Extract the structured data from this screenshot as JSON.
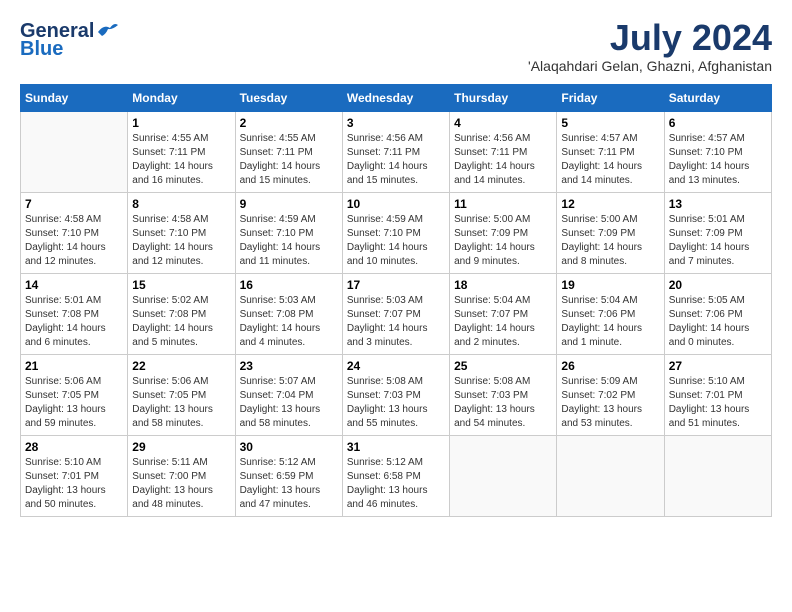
{
  "header": {
    "logo_general": "General",
    "logo_blue": "Blue",
    "title": "July 2024",
    "location": "'Alaqahdari Gelan, Ghazni, Afghanistan"
  },
  "days_of_week": [
    "Sunday",
    "Monday",
    "Tuesday",
    "Wednesday",
    "Thursday",
    "Friday",
    "Saturday"
  ],
  "weeks": [
    [
      {
        "day": "",
        "info": ""
      },
      {
        "day": "1",
        "info": "Sunrise: 4:55 AM\nSunset: 7:11 PM\nDaylight: 14 hours\nand 16 minutes."
      },
      {
        "day": "2",
        "info": "Sunrise: 4:55 AM\nSunset: 7:11 PM\nDaylight: 14 hours\nand 15 minutes."
      },
      {
        "day": "3",
        "info": "Sunrise: 4:56 AM\nSunset: 7:11 PM\nDaylight: 14 hours\nand 15 minutes."
      },
      {
        "day": "4",
        "info": "Sunrise: 4:56 AM\nSunset: 7:11 PM\nDaylight: 14 hours\nand 14 minutes."
      },
      {
        "day": "5",
        "info": "Sunrise: 4:57 AM\nSunset: 7:11 PM\nDaylight: 14 hours\nand 14 minutes."
      },
      {
        "day": "6",
        "info": "Sunrise: 4:57 AM\nSunset: 7:10 PM\nDaylight: 14 hours\nand 13 minutes."
      }
    ],
    [
      {
        "day": "7",
        "info": "Sunrise: 4:58 AM\nSunset: 7:10 PM\nDaylight: 14 hours\nand 12 minutes."
      },
      {
        "day": "8",
        "info": "Sunrise: 4:58 AM\nSunset: 7:10 PM\nDaylight: 14 hours\nand 12 minutes."
      },
      {
        "day": "9",
        "info": "Sunrise: 4:59 AM\nSunset: 7:10 PM\nDaylight: 14 hours\nand 11 minutes."
      },
      {
        "day": "10",
        "info": "Sunrise: 4:59 AM\nSunset: 7:10 PM\nDaylight: 14 hours\nand 10 minutes."
      },
      {
        "day": "11",
        "info": "Sunrise: 5:00 AM\nSunset: 7:09 PM\nDaylight: 14 hours\nand 9 minutes."
      },
      {
        "day": "12",
        "info": "Sunrise: 5:00 AM\nSunset: 7:09 PM\nDaylight: 14 hours\nand 8 minutes."
      },
      {
        "day": "13",
        "info": "Sunrise: 5:01 AM\nSunset: 7:09 PM\nDaylight: 14 hours\nand 7 minutes."
      }
    ],
    [
      {
        "day": "14",
        "info": "Sunrise: 5:01 AM\nSunset: 7:08 PM\nDaylight: 14 hours\nand 6 minutes."
      },
      {
        "day": "15",
        "info": "Sunrise: 5:02 AM\nSunset: 7:08 PM\nDaylight: 14 hours\nand 5 minutes."
      },
      {
        "day": "16",
        "info": "Sunrise: 5:03 AM\nSunset: 7:08 PM\nDaylight: 14 hours\nand 4 minutes."
      },
      {
        "day": "17",
        "info": "Sunrise: 5:03 AM\nSunset: 7:07 PM\nDaylight: 14 hours\nand 3 minutes."
      },
      {
        "day": "18",
        "info": "Sunrise: 5:04 AM\nSunset: 7:07 PM\nDaylight: 14 hours\nand 2 minutes."
      },
      {
        "day": "19",
        "info": "Sunrise: 5:04 AM\nSunset: 7:06 PM\nDaylight: 14 hours\nand 1 minute."
      },
      {
        "day": "20",
        "info": "Sunrise: 5:05 AM\nSunset: 7:06 PM\nDaylight: 14 hours\nand 0 minutes."
      }
    ],
    [
      {
        "day": "21",
        "info": "Sunrise: 5:06 AM\nSunset: 7:05 PM\nDaylight: 13 hours\nand 59 minutes."
      },
      {
        "day": "22",
        "info": "Sunrise: 5:06 AM\nSunset: 7:05 PM\nDaylight: 13 hours\nand 58 minutes."
      },
      {
        "day": "23",
        "info": "Sunrise: 5:07 AM\nSunset: 7:04 PM\nDaylight: 13 hours\nand 58 minutes."
      },
      {
        "day": "24",
        "info": "Sunrise: 5:08 AM\nSunset: 7:03 PM\nDaylight: 13 hours\nand 55 minutes."
      },
      {
        "day": "25",
        "info": "Sunrise: 5:08 AM\nSunset: 7:03 PM\nDaylight: 13 hours\nand 54 minutes."
      },
      {
        "day": "26",
        "info": "Sunrise: 5:09 AM\nSunset: 7:02 PM\nDaylight: 13 hours\nand 53 minutes."
      },
      {
        "day": "27",
        "info": "Sunrise: 5:10 AM\nSunset: 7:01 PM\nDaylight: 13 hours\nand 51 minutes."
      }
    ],
    [
      {
        "day": "28",
        "info": "Sunrise: 5:10 AM\nSunset: 7:01 PM\nDaylight: 13 hours\nand 50 minutes."
      },
      {
        "day": "29",
        "info": "Sunrise: 5:11 AM\nSunset: 7:00 PM\nDaylight: 13 hours\nand 48 minutes."
      },
      {
        "day": "30",
        "info": "Sunrise: 5:12 AM\nSunset: 6:59 PM\nDaylight: 13 hours\nand 47 minutes."
      },
      {
        "day": "31",
        "info": "Sunrise: 5:12 AM\nSunset: 6:58 PM\nDaylight: 13 hours\nand 46 minutes."
      },
      {
        "day": "",
        "info": ""
      },
      {
        "day": "",
        "info": ""
      },
      {
        "day": "",
        "info": ""
      }
    ]
  ]
}
